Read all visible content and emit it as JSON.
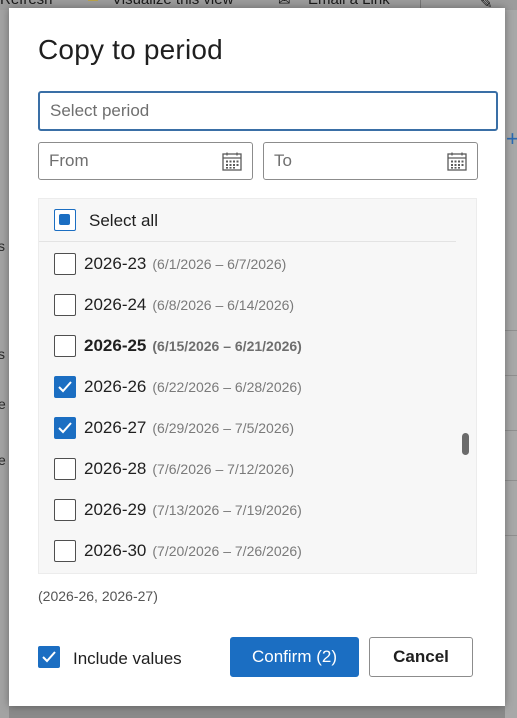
{
  "background": {
    "toolbar_items": [
      "Refresh",
      "Visualize this view",
      "Email a Link"
    ]
  },
  "dialog": {
    "title": "Copy to period",
    "period_input": {
      "placeholder": "Select period",
      "value": ""
    },
    "from_input": {
      "placeholder": "From",
      "icon": "calendar-icon"
    },
    "to_input": {
      "placeholder": "To",
      "icon": "calendar-icon"
    },
    "select_all": {
      "label": "Select all",
      "state": "partial"
    },
    "periods": [
      {
        "name": "2026-23",
        "range": "(6/1/2026 – 6/7/2026)",
        "checked": false,
        "current": false
      },
      {
        "name": "2026-24",
        "range": "(6/8/2026 – 6/14/2026)",
        "checked": false,
        "current": false
      },
      {
        "name": "2026-25",
        "range": "(6/15/2026 – 6/21/2026)",
        "checked": false,
        "current": true
      },
      {
        "name": "2026-26",
        "range": "(6/22/2026 – 6/28/2026)",
        "checked": true,
        "current": false
      },
      {
        "name": "2026-27",
        "range": "(6/29/2026 – 7/5/2026)",
        "checked": true,
        "current": false
      },
      {
        "name": "2026-28",
        "range": "(7/6/2026 – 7/12/2026)",
        "checked": false,
        "current": false
      },
      {
        "name": "2026-29",
        "range": "(7/13/2026 – 7/19/2026)",
        "checked": false,
        "current": false
      },
      {
        "name": "2026-30",
        "range": "(7/20/2026 – 7/26/2026)",
        "checked": false,
        "current": false
      }
    ],
    "selected_summary": "(2026-26, 2026-27)",
    "include_values": {
      "label": "Include values",
      "checked": true
    },
    "confirm_label": "Confirm (2)",
    "cancel_label": "Cancel"
  },
  "colors": {
    "accent": "#1b6ec2",
    "focus_border": "#3a6fa6",
    "overlay": "#8a8a8a"
  }
}
